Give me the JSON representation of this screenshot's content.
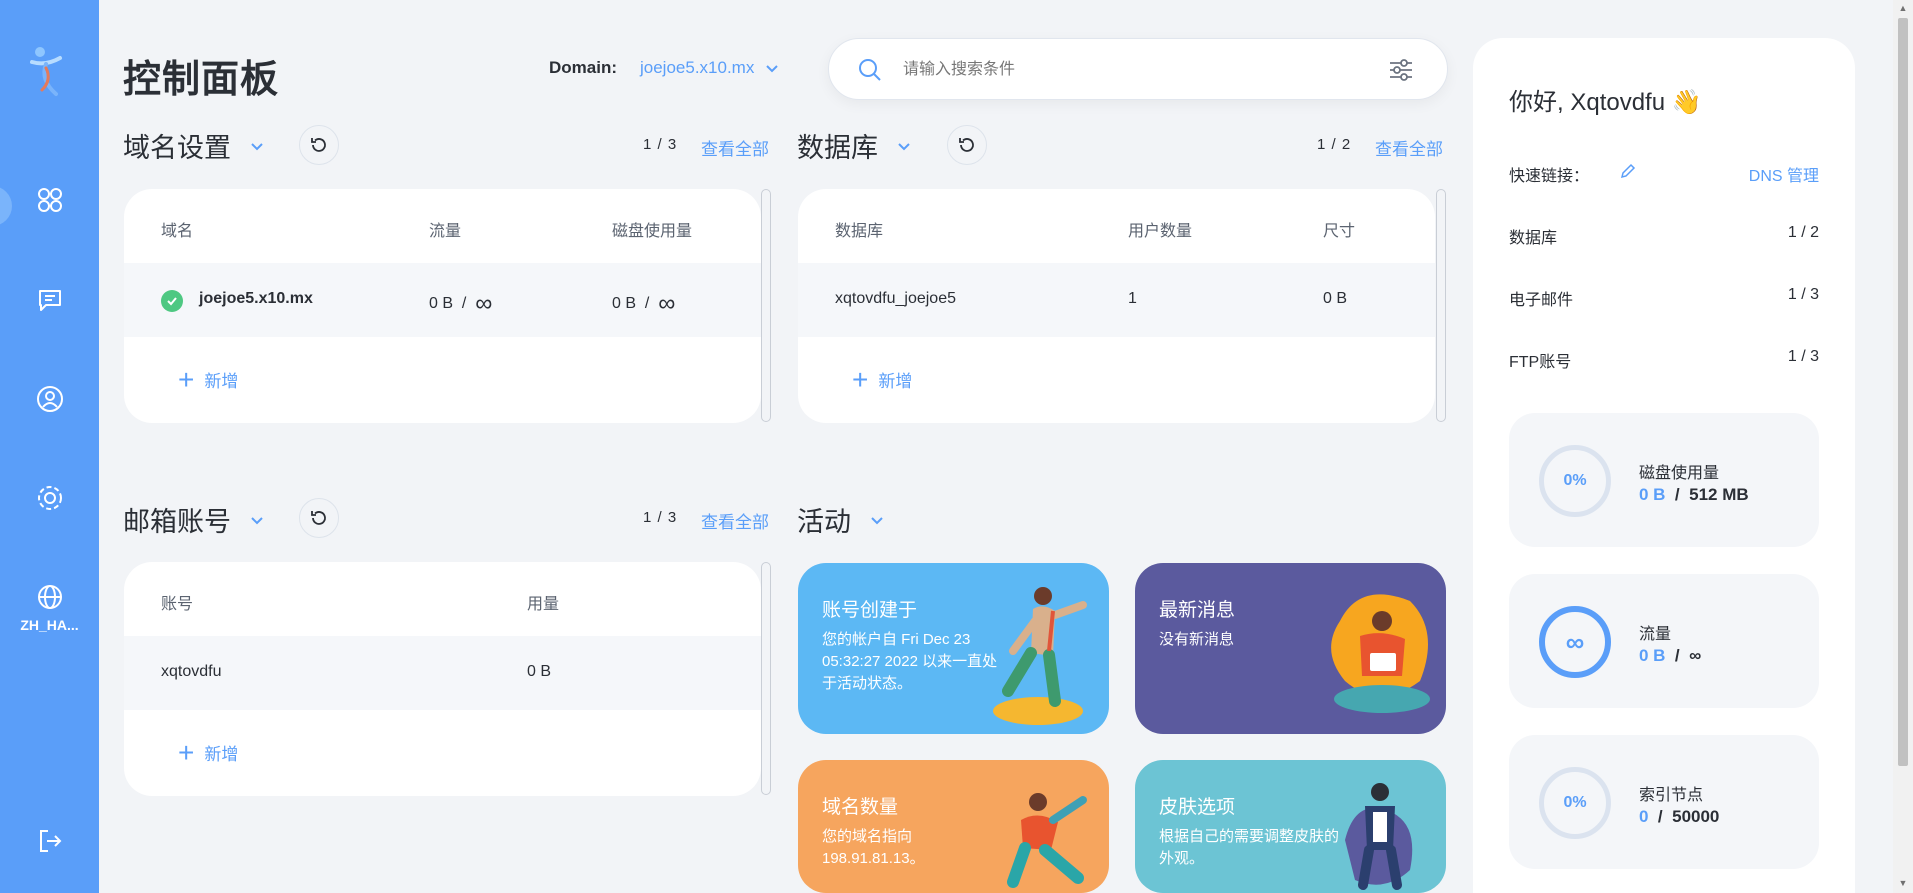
{
  "sidebar": {
    "items": [
      {
        "icon": "grid-icon",
        "label": ""
      },
      {
        "icon": "message-icon",
        "label": ""
      },
      {
        "icon": "user-icon",
        "label": ""
      },
      {
        "icon": "settings-icon",
        "label": ""
      },
      {
        "icon": "globe-icon",
        "label": "ZH_HA..."
      },
      {
        "icon": "logout-icon",
        "label": ""
      }
    ]
  },
  "header": {
    "title": "控制面板",
    "domain_label": "Domain:",
    "domain_value": "joejoe5.x10.mx",
    "search_placeholder": "请输入搜索条件"
  },
  "domains": {
    "title": "域名设置",
    "pager": "1 / 3",
    "view_all": "查看全部",
    "columns": [
      "域名",
      "流量",
      "磁盘使用量"
    ],
    "row": {
      "name": "joejoe5.x10.mx",
      "traffic_used": "0 B",
      "traffic_sep": "/",
      "traffic_limit": "∞",
      "disk_used": "0 B",
      "disk_sep": "/",
      "disk_limit": "∞"
    },
    "add": "新增"
  },
  "databases": {
    "title": "数据库",
    "pager": "1 / 2",
    "view_all": "查看全部",
    "columns": [
      "数据库",
      "用户数量",
      "尺寸"
    ],
    "row": {
      "name": "xqtovdfu_joejoe5",
      "users": "1",
      "size": "0 B"
    },
    "add": "新增"
  },
  "email": {
    "title": "邮箱账号",
    "pager": "1 / 3",
    "view_all": "查看全部",
    "columns": [
      "账号",
      "用量"
    ],
    "row": {
      "account": "xqtovdfu",
      "usage": "0 B"
    },
    "add": "新增"
  },
  "activity": {
    "title": "活动",
    "tiles": [
      {
        "title": "账号创建于",
        "text": "您的帐户自 Fri Dec 23 05:32:27 2022 以来一直处于活动状态。",
        "color": "#5cb8f4"
      },
      {
        "title": "最新消息",
        "text": "没有新消息",
        "color": "#5b5a9e"
      },
      {
        "title": "域名数量",
        "text": "您的域名指向 198.91.81.13。",
        "color": "#f6a55e"
      },
      {
        "title": "皮肤选项",
        "text": "根据自己的需要调整皮肤的外观。",
        "color": "#6cc4d4"
      }
    ]
  },
  "panel": {
    "greeting": "你好, Xqtovdfu 👋",
    "quick_links": "快速链接：",
    "dns": "DNS 管理",
    "rows": [
      {
        "label": "数据库",
        "value": "1 / 2"
      },
      {
        "label": "电子邮件",
        "value": "1 / 3"
      },
      {
        "label": "FTP账号",
        "value": "1 / 3"
      }
    ],
    "stats": [
      {
        "ring": "0%",
        "label": "磁盘使用量",
        "current": "0 B",
        "sep": "/",
        "limit": "512 MB",
        "fraction": 0
      },
      {
        "ring": "∞",
        "label": "流量",
        "current": "0 B",
        "sep": "/",
        "limit": "∞",
        "fraction": 1
      },
      {
        "ring": "0%",
        "label": "索引节点",
        "current": "0",
        "sep": "/",
        "limit": "50000",
        "fraction": 0
      }
    ]
  },
  "colors": {
    "accent": "#5a9ef9",
    "sidebar": "#5a9ef9",
    "success": "#4ec882"
  }
}
